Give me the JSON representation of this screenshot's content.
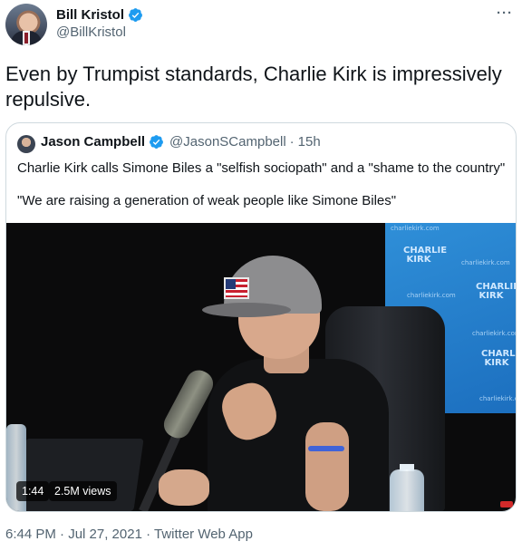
{
  "author": {
    "display_name": "Bill Kristol",
    "handle": "@BillKristol",
    "verified": true
  },
  "tweet": {
    "text": "Even by Trumpist standards, Charlie Kirk is impressively repulsive."
  },
  "more_menu": {
    "label": "···"
  },
  "quoted_tweet": {
    "display_name": "Jason Campbell",
    "handle": "@JasonSCampbell",
    "separator": "·",
    "time": "15h",
    "verified": true,
    "text_line1": "Charlie Kirk calls Simone Biles a \"selfish sociopath\" and a \"shame to the country\"",
    "text_line2": "\"We are raising a generation of weak people like Simone Biles\"",
    "video": {
      "duration": "1:44",
      "views": "2.5M views",
      "backdrop_logos": [
        "CHARLIE KIRK",
        "CHARLIE KIRK",
        "CHARLIE KIRK"
      ],
      "backdrop_urls": [
        "charliekirk.com",
        "charliekirk.com",
        "charliekirk.com",
        "charliekirk.com",
        "charliekirk.com",
        "charliekirk.com"
      ]
    }
  },
  "footer": {
    "timestamp": "6:44 PM · Jul 27, 2021 · Twitter Web App"
  },
  "colors": {
    "verified_blue": "#1d9bf0",
    "secondary_text": "#536471",
    "border": "#cfd9de"
  }
}
